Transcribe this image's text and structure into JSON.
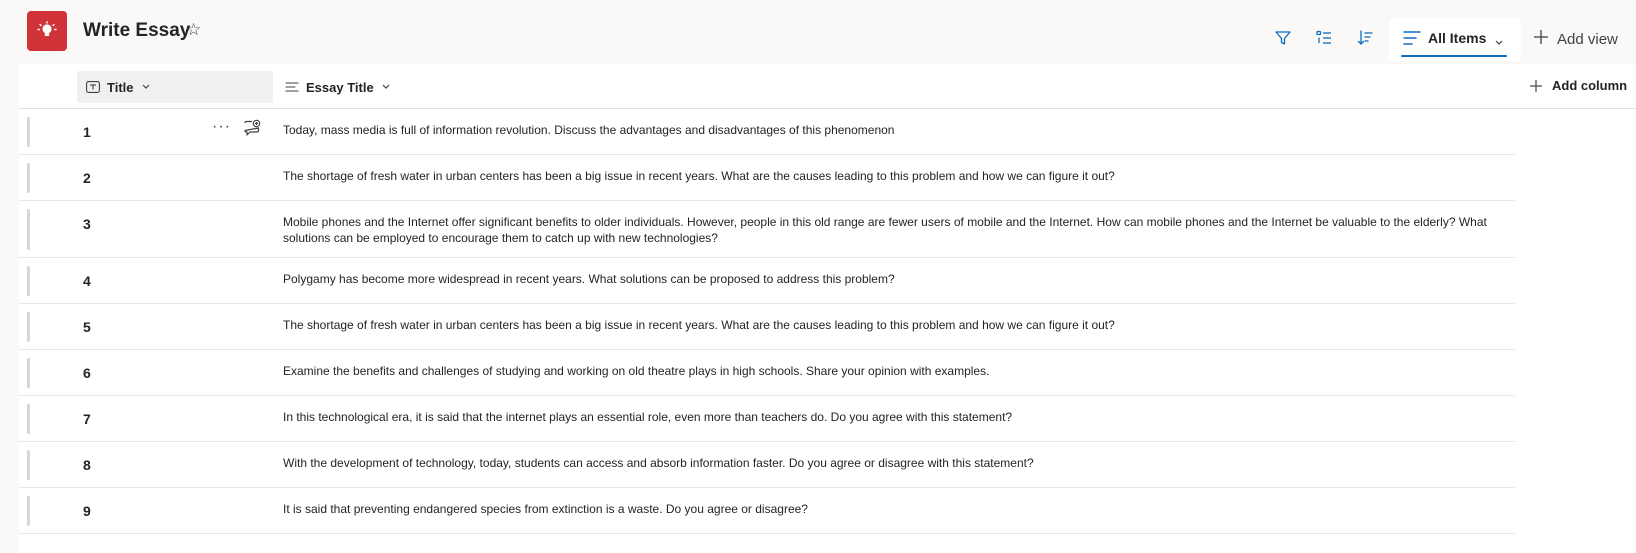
{
  "header": {
    "list_title": "Write Essay",
    "star_glyph": "☆",
    "app_icon": "lightbulb-icon",
    "app_icon_color": "#d13438"
  },
  "toolbar": {
    "filter_icon": "filter-icon",
    "group_icon": "group-by-icon",
    "sort_icon": "sort-icon",
    "view_label": "All Items",
    "add_view_label": "Add view",
    "accent_color": "#0f6cbd"
  },
  "columns": {
    "title_label": "Title",
    "essay_title_label": "Essay Title",
    "add_column_label": "Add column"
  },
  "rows": [
    {
      "num": "1",
      "text": "Today, mass media is full of information revolution. Discuss the advantages and disadvantages of this phenomenon"
    },
    {
      "num": "2",
      "text": "The shortage of fresh water in urban centers has been a big issue in recent years. What are the causes leading to this problem and how we can figure it out?"
    },
    {
      "num": "3",
      "text": "Mobile phones and the Internet offer significant benefits to older individuals. However, people in this old range are fewer users of mobile and the Internet. How can mobile phones and the Internet be valuable to the elderly? What solutions can be employed to encourage them to catch up with new technologies?"
    },
    {
      "num": "4",
      "text": "Polygamy has become more widespread in recent years. What solutions can be proposed to address this problem?"
    },
    {
      "num": "5",
      "text": "The shortage of fresh water in urban centers has been a big issue in recent years. What are the causes leading to this problem and how we can figure it out?"
    },
    {
      "num": "6",
      "text": "Examine the benefits and challenges of studying and working on old theatre plays in high schools. Share your opinion with examples."
    },
    {
      "num": "7",
      "text": "In this technological era, it is said that the internet plays an essential role, even more than teachers do. Do you agree with this statement?"
    },
    {
      "num": "8",
      "text": "With the development of technology, today, students can access and absorb information faster. Do you agree or disagree with this statement?"
    },
    {
      "num": "9",
      "text": "It is said that preventing endangered species from extinction is a waste. Do you agree or disagree?"
    }
  ],
  "row_actions": {
    "more_glyph": "···",
    "comment_icon": "add-comment-icon"
  }
}
